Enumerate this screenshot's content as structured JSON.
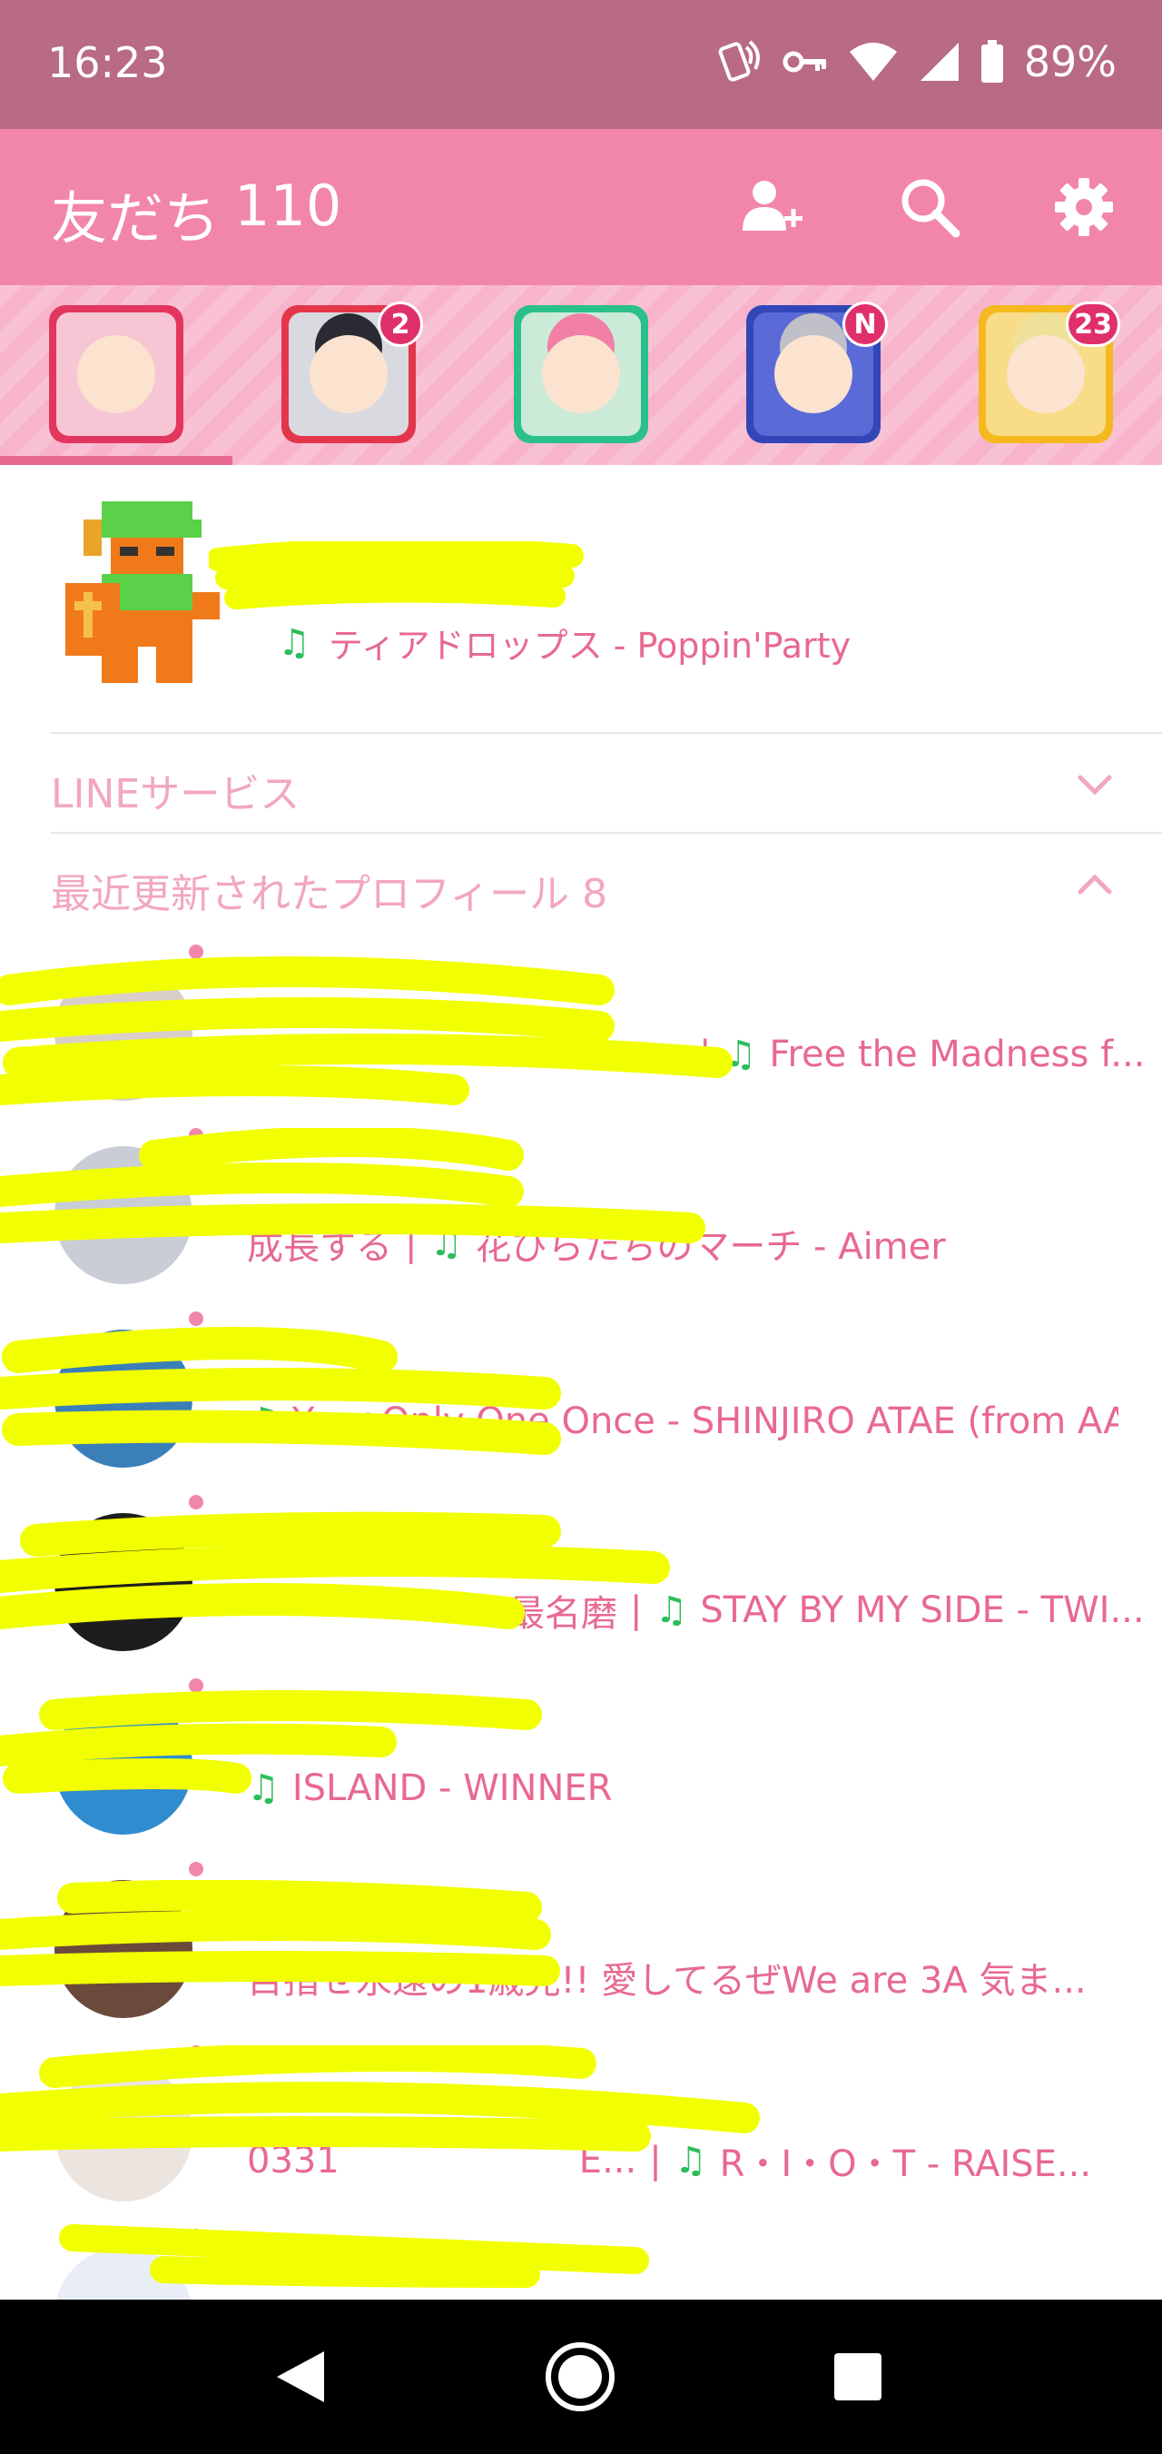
{
  "status_bar": {
    "time": "16:23",
    "battery": "89%"
  },
  "header": {
    "title": "友だち",
    "count": "110"
  },
  "theme_tabs": [
    {
      "name": "tab-1",
      "badge": ""
    },
    {
      "name": "tab-2",
      "badge": "2"
    },
    {
      "name": "tab-3",
      "badge": ""
    },
    {
      "name": "tab-4",
      "badge": "N"
    },
    {
      "name": "tab-5",
      "badge": "23"
    }
  ],
  "my_profile": {
    "song": "ティアドロップス - Poppin'Party"
  },
  "sections": {
    "line_services": "LINEサービス",
    "recent_profiles": "最近更新されたプロフィール 8"
  },
  "friends": [
    {
      "name": "",
      "status": "",
      "song": "Free the Madness f..."
    },
    {
      "name": "",
      "status": "成長する",
      "song": "花びらたちのマーチ - Aimer"
    },
    {
      "name": "",
      "status": "",
      "song": "Your Only One Once - SHINJIRO ATAE (from AA..."
    },
    {
      "name": "",
      "status": "最名磨",
      "song": "STAY BY MY SIDE - TWI..."
    },
    {
      "name": "",
      "status": "",
      "song": "ISLAND - WINNER"
    },
    {
      "name": "",
      "status": "目指せ永遠の1歳児!! 愛してるぜWe are 3A 気ま...",
      "song": ""
    },
    {
      "name": "",
      "status": "0331",
      "status2": "E...",
      "song": "R・I・O・T - RAISE..."
    },
    {
      "name": "",
      "status": "",
      "song": ""
    }
  ],
  "colors": {
    "status_bar": "#b86a86",
    "header": "#f285ab",
    "accent": "#e8698f",
    "music_note": "#2cbd5a",
    "redaction": "#f2ff00"
  }
}
